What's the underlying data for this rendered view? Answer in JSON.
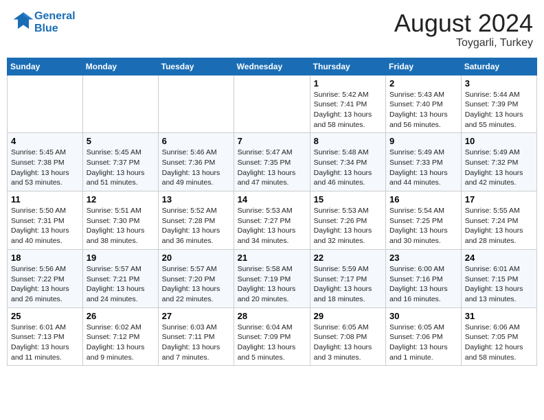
{
  "header": {
    "logo_line1": "General",
    "logo_line2": "Blue",
    "month": "August 2024",
    "location": "Toygarli, Turkey"
  },
  "weekdays": [
    "Sunday",
    "Monday",
    "Tuesday",
    "Wednesday",
    "Thursday",
    "Friday",
    "Saturday"
  ],
  "weeks": [
    [
      {
        "day": "",
        "info": ""
      },
      {
        "day": "",
        "info": ""
      },
      {
        "day": "",
        "info": ""
      },
      {
        "day": "",
        "info": ""
      },
      {
        "day": "1",
        "info": "Sunrise: 5:42 AM\nSunset: 7:41 PM\nDaylight: 13 hours\nand 58 minutes."
      },
      {
        "day": "2",
        "info": "Sunrise: 5:43 AM\nSunset: 7:40 PM\nDaylight: 13 hours\nand 56 minutes."
      },
      {
        "day": "3",
        "info": "Sunrise: 5:44 AM\nSunset: 7:39 PM\nDaylight: 13 hours\nand 55 minutes."
      }
    ],
    [
      {
        "day": "4",
        "info": "Sunrise: 5:45 AM\nSunset: 7:38 PM\nDaylight: 13 hours\nand 53 minutes."
      },
      {
        "day": "5",
        "info": "Sunrise: 5:45 AM\nSunset: 7:37 PM\nDaylight: 13 hours\nand 51 minutes."
      },
      {
        "day": "6",
        "info": "Sunrise: 5:46 AM\nSunset: 7:36 PM\nDaylight: 13 hours\nand 49 minutes."
      },
      {
        "day": "7",
        "info": "Sunrise: 5:47 AM\nSunset: 7:35 PM\nDaylight: 13 hours\nand 47 minutes."
      },
      {
        "day": "8",
        "info": "Sunrise: 5:48 AM\nSunset: 7:34 PM\nDaylight: 13 hours\nand 46 minutes."
      },
      {
        "day": "9",
        "info": "Sunrise: 5:49 AM\nSunset: 7:33 PM\nDaylight: 13 hours\nand 44 minutes."
      },
      {
        "day": "10",
        "info": "Sunrise: 5:49 AM\nSunset: 7:32 PM\nDaylight: 13 hours\nand 42 minutes."
      }
    ],
    [
      {
        "day": "11",
        "info": "Sunrise: 5:50 AM\nSunset: 7:31 PM\nDaylight: 13 hours\nand 40 minutes."
      },
      {
        "day": "12",
        "info": "Sunrise: 5:51 AM\nSunset: 7:30 PM\nDaylight: 13 hours\nand 38 minutes."
      },
      {
        "day": "13",
        "info": "Sunrise: 5:52 AM\nSunset: 7:28 PM\nDaylight: 13 hours\nand 36 minutes."
      },
      {
        "day": "14",
        "info": "Sunrise: 5:53 AM\nSunset: 7:27 PM\nDaylight: 13 hours\nand 34 minutes."
      },
      {
        "day": "15",
        "info": "Sunrise: 5:53 AM\nSunset: 7:26 PM\nDaylight: 13 hours\nand 32 minutes."
      },
      {
        "day": "16",
        "info": "Sunrise: 5:54 AM\nSunset: 7:25 PM\nDaylight: 13 hours\nand 30 minutes."
      },
      {
        "day": "17",
        "info": "Sunrise: 5:55 AM\nSunset: 7:24 PM\nDaylight: 13 hours\nand 28 minutes."
      }
    ],
    [
      {
        "day": "18",
        "info": "Sunrise: 5:56 AM\nSunset: 7:22 PM\nDaylight: 13 hours\nand 26 minutes."
      },
      {
        "day": "19",
        "info": "Sunrise: 5:57 AM\nSunset: 7:21 PM\nDaylight: 13 hours\nand 24 minutes."
      },
      {
        "day": "20",
        "info": "Sunrise: 5:57 AM\nSunset: 7:20 PM\nDaylight: 13 hours\nand 22 minutes."
      },
      {
        "day": "21",
        "info": "Sunrise: 5:58 AM\nSunset: 7:19 PM\nDaylight: 13 hours\nand 20 minutes."
      },
      {
        "day": "22",
        "info": "Sunrise: 5:59 AM\nSunset: 7:17 PM\nDaylight: 13 hours\nand 18 minutes."
      },
      {
        "day": "23",
        "info": "Sunrise: 6:00 AM\nSunset: 7:16 PM\nDaylight: 13 hours\nand 16 minutes."
      },
      {
        "day": "24",
        "info": "Sunrise: 6:01 AM\nSunset: 7:15 PM\nDaylight: 13 hours\nand 13 minutes."
      }
    ],
    [
      {
        "day": "25",
        "info": "Sunrise: 6:01 AM\nSunset: 7:13 PM\nDaylight: 13 hours\nand 11 minutes."
      },
      {
        "day": "26",
        "info": "Sunrise: 6:02 AM\nSunset: 7:12 PM\nDaylight: 13 hours\nand 9 minutes."
      },
      {
        "day": "27",
        "info": "Sunrise: 6:03 AM\nSunset: 7:11 PM\nDaylight: 13 hours\nand 7 minutes."
      },
      {
        "day": "28",
        "info": "Sunrise: 6:04 AM\nSunset: 7:09 PM\nDaylight: 13 hours\nand 5 minutes."
      },
      {
        "day": "29",
        "info": "Sunrise: 6:05 AM\nSunset: 7:08 PM\nDaylight: 13 hours\nand 3 minutes."
      },
      {
        "day": "30",
        "info": "Sunrise: 6:05 AM\nSunset: 7:06 PM\nDaylight: 13 hours\nand 1 minute."
      },
      {
        "day": "31",
        "info": "Sunrise: 6:06 AM\nSunset: 7:05 PM\nDaylight: 12 hours\nand 58 minutes."
      }
    ]
  ]
}
